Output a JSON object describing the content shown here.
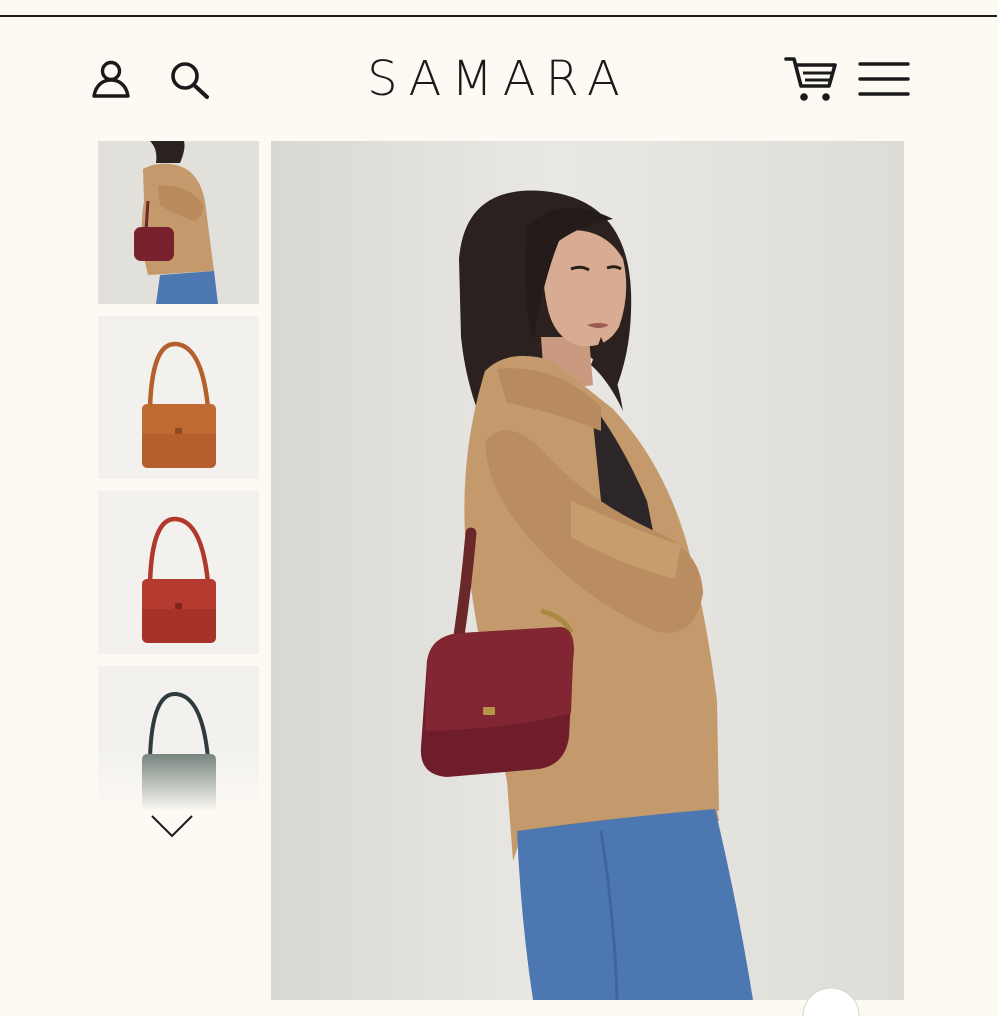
{
  "header": {
    "brand": "SAMARA",
    "icons": {
      "account": "user-icon",
      "search": "search-icon",
      "cart": "cart-icon",
      "menu": "hamburger-menu-icon"
    }
  },
  "gallery": {
    "thumbnails": [
      {
        "subject": "model-with-crimson-bag",
        "selected": true,
        "color": "#7a2130"
      },
      {
        "subject": "cognac-bag",
        "selected": false,
        "color": "#b45f2c"
      },
      {
        "subject": "red-bag",
        "selected": false,
        "color": "#b0382c"
      },
      {
        "subject": "sage-bag",
        "selected": false,
        "color": "#6f7f78"
      }
    ],
    "main_image": {
      "subject": "model-with-crimson-bag"
    },
    "scroll_down": "chevron-down-icon"
  },
  "colors": {
    "background": "#fdf9f3",
    "text": "#1a1a1a",
    "blazer": "#c49a6c",
    "bag": "#7a2130",
    "denim": "#4d77b0"
  }
}
